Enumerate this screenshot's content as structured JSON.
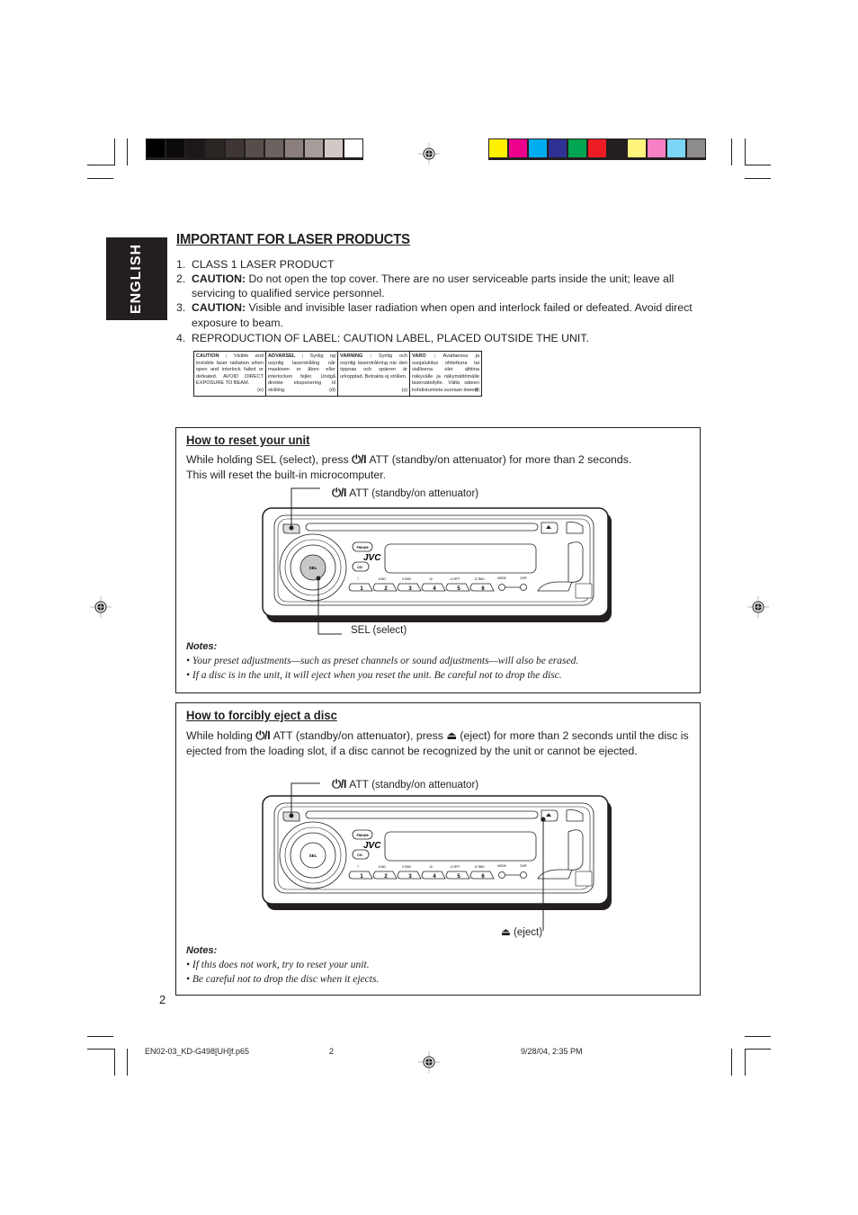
{
  "color_bars": {
    "grayscale": [
      "#000000",
      "#0d0b0a",
      "#1b1817",
      "#2a2624",
      "#3e3634",
      "#574d4b",
      "#6c625f",
      "#8a7f7d",
      "#a69d9b",
      "#d2c9c7",
      "#ffffff"
    ],
    "process": [
      "#fff200",
      "#ec008c",
      "#00aeef",
      "#2e3192",
      "#00a651",
      "#ed1c24",
      "#231f20",
      "#fff57d",
      "#f580c3",
      "#7dd5f5",
      "#8d8b8c"
    ]
  },
  "side_tab": {
    "label": "ENGLISH"
  },
  "header": {
    "title": "IMPORTANT FOR LASER PRODUCTS"
  },
  "laser_list": [
    {
      "num": "1.",
      "bold": "",
      "text": "CLASS 1 LASER PRODUCT"
    },
    {
      "num": "2.",
      "bold": "CAUTION:",
      "text": " Do not open the top cover. There are no user serviceable parts inside the unit; leave all servicing to qualified service personnel."
    },
    {
      "num": "3.",
      "bold": "CAUTION:",
      "text": " Visible and invisible laser radiation when open and interlock failed or defeated. Avoid direct exposure to beam."
    },
    {
      "num": "4.",
      "bold": "",
      "text": "REPRODUCTION OF LABEL: CAUTION LABEL, PLACED OUTSIDE THE UNIT."
    }
  ],
  "caution_label": [
    {
      "heading": "CAUTION :",
      "text": " Visible and invisible laser radiation when open and interlock failed or defeated. AVOID DIRECT EXPOSURE TO BEAM.",
      "tag": "(e)"
    },
    {
      "heading": "ADVARSEL :",
      "text": " Synlig og usynlig laserstråling når maskinen er åben eller interlocken fejler. Undgå direkte eksponering til stråling.",
      "tag": "(d)"
    },
    {
      "heading": "VARNING :",
      "text": " Synlig och osynlig laserstrålning när den öppnas och spärren är urkopplad. Betrakta ej strålen.",
      "tag": "(s)"
    },
    {
      "heading": "VARO :",
      "text": " Avattaessa ja suojalukitus ohitettuna tai viallisena olet alttiina näkyvälle ja näkymättömälle lasersäteilylle. Vältä säteen kohdistumista suoraan itseesi.",
      "tag": "(f)"
    }
  ],
  "reset_section": {
    "title": "How to reset your unit",
    "para_before": "While holding SEL (select), press ",
    "power_symbol": "⏻/I",
    "att_label": "ATT",
    "para_after": " (standby/on attenuator) for more than 2 seconds.",
    "para_line2": "This will reset the built-in microcomputer.",
    "callout_top": " (standby/on attenuator)",
    "callout_bottom": "SEL (select)",
    "notes_title": "Notes:",
    "notes": [
      "Your preset adjustments—such as preset channels or sound adjustments—will also be erased.",
      "If a disc is in the unit, it will eject when you reset the unit. Be careful not to drop the disc."
    ]
  },
  "eject_section": {
    "title": "How to forcibly eject a disc",
    "para_before": "While holding ",
    "power_symbol": "⏻/I",
    "att_label": "ATT",
    "para_mid": " (standby/on attenuator), press ",
    "eject_symbol": "⏏",
    "para_after": " (eject) for more than 2 seconds until the disc is ejected from the loading slot, if a disc cannot be recognized by the unit or cannot be ejected.",
    "callout_top": " (standby/on attenuator)",
    "callout_eject": " (eject)",
    "notes_title": "Notes:",
    "notes": [
      "If this does not work, try to reset your unit.",
      "Be careful not to drop the disc when it ejects."
    ]
  },
  "device": {
    "brand": "JVC",
    "sel_label": "SEL",
    "fm_am_label": "FM/AM",
    "cd_label": "CD",
    "preset_buttons": [
      "1",
      "2",
      "3",
      "4",
      "5",
      "6"
    ],
    "preset_captions": [
      "7",
      "8 MO",
      "9 SSM",
      "10",
      "11 RPT",
      "12 RND"
    ],
    "mode_label": "MODE",
    "disp_label": "DISP"
  },
  "page_number": "2",
  "footer": {
    "file": "EN02-03_KD-G498[UH]f.p65",
    "page": "2",
    "timestamp": "9/28/04, 2:35 PM"
  }
}
